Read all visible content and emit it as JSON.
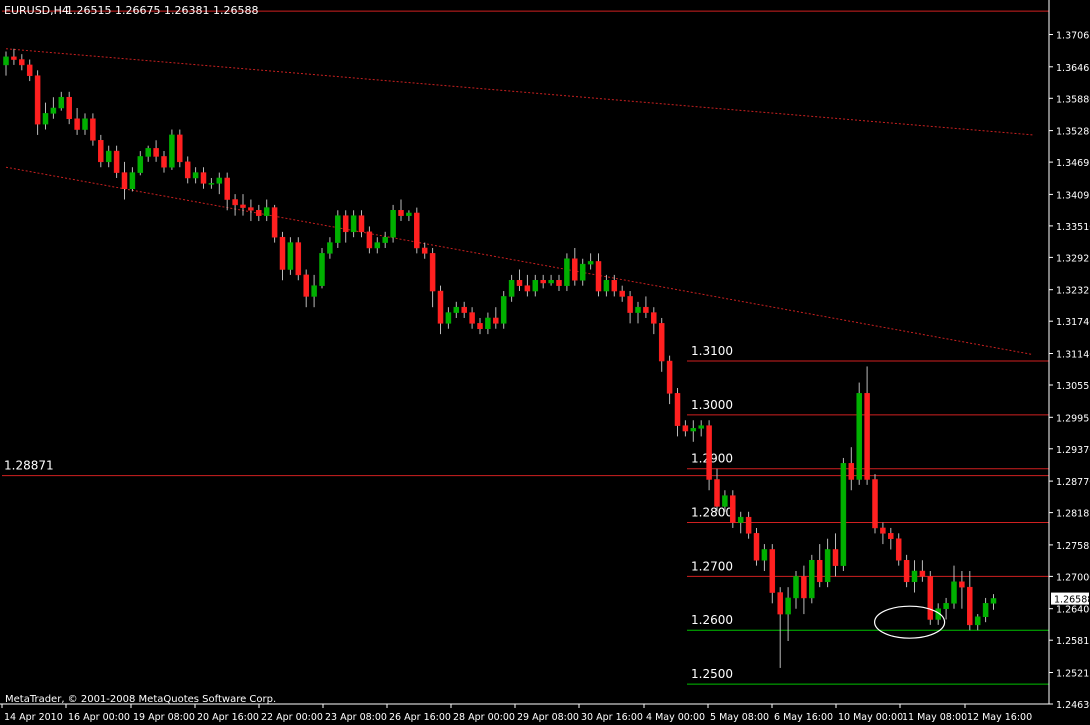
{
  "header": {
    "symbol": "EURUSD,H4",
    "ohlc": "1.26515 1.26675 1.26381 1.26588"
  },
  "footer": {
    "copyright": "MetaTrader, © 2001-2008 MetaQuotes Software Corp."
  },
  "colors": {
    "background": "#000000",
    "bull": "#00b000",
    "bear": "#ff2020",
    "level_line": "#d02020",
    "support_line": "#00c000",
    "trend_line": "#c82020",
    "axis": "#ffffff"
  },
  "chart_data": {
    "type": "candlestick",
    "timeframe": "H4",
    "ylim": [
      1.2463,
      1.3765
    ],
    "y_ticks": [
      "1.37065",
      "1.36465",
      "1.35880",
      "1.35280",
      "1.34695",
      "1.34095",
      "1.33510",
      "1.32925",
      "1.32325",
      "1.31740",
      "1.31140",
      "1.30555",
      "1.29955",
      "1.29370",
      "1.28770",
      "1.28185",
      "1.27585",
      "1.27000",
      "1.26400",
      "1.25815",
      "1.25215",
      "1.24630"
    ],
    "x_ticks": [
      "14 Apr 2010",
      "16 Apr 00:00",
      "19 Apr 08:00",
      "20 Apr 16:00",
      "22 Apr 00:00",
      "23 Apr 08:00",
      "26 Apr 16:00",
      "28 Apr 00:00",
      "29 Apr 08:00",
      "30 Apr 16:00",
      "4 May 00:00",
      "5 May 08:00",
      "6 May 16:00",
      "10 May 00:00",
      "11 May 08:00",
      "12 May 16:00"
    ],
    "current_price": "1.26588",
    "horizontal_levels": [
      {
        "label": "1.3100",
        "value": 1.31,
        "color": "red"
      },
      {
        "label": "1.3000",
        "value": 1.3,
        "color": "red"
      },
      {
        "label": "1.2900",
        "value": 1.29,
        "color": "red"
      },
      {
        "label": "1.2800",
        "value": 1.28,
        "color": "red"
      },
      {
        "label": "1.2700",
        "value": 1.27,
        "color": "red"
      },
      {
        "label": "1.2600",
        "value": 1.26,
        "color": "green"
      },
      {
        "label": "1.2500",
        "value": 1.25,
        "color": "green"
      }
    ],
    "extra_levels": [
      {
        "label": "1.28871",
        "value": 1.28871
      },
      {
        "label": "",
        "value": 1.375
      }
    ],
    "trend_lines": [
      {
        "from": {
          "bar": 0,
          "price": 1.368
        },
        "to": {
          "bar": 130,
          "price": 1.352
        }
      },
      {
        "from": {
          "bar": 0,
          "price": 1.346
        },
        "to": {
          "bar": 130,
          "price": 1.3112
        }
      }
    ],
    "annotation": {
      "type": "ellipse",
      "bar": 114,
      "price": 1.2615
    },
    "candles": [
      [
        1.365,
        1.3675,
        1.363,
        1.3665
      ],
      [
        1.3665,
        1.368,
        1.365,
        1.366
      ],
      [
        1.366,
        1.367,
        1.364,
        1.365
      ],
      [
        1.365,
        1.366,
        1.362,
        1.363
      ],
      [
        1.363,
        1.364,
        1.352,
        1.354
      ],
      [
        1.354,
        1.358,
        1.353,
        1.356
      ],
      [
        1.356,
        1.359,
        1.355,
        1.357
      ],
      [
        1.357,
        1.36,
        1.3565,
        1.359
      ],
      [
        1.359,
        1.36,
        1.354,
        1.355
      ],
      [
        1.355,
        1.357,
        1.352,
        1.353
      ],
      [
        1.353,
        1.356,
        1.352,
        1.355
      ],
      [
        1.355,
        1.356,
        1.35,
        1.351
      ],
      [
        1.351,
        1.352,
        1.346,
        1.347
      ],
      [
        1.347,
        1.35,
        1.346,
        1.349
      ],
      [
        1.349,
        1.35,
        1.344,
        1.345
      ],
      [
        1.345,
        1.347,
        1.34,
        1.342
      ],
      [
        1.342,
        1.346,
        1.3415,
        1.345
      ],
      [
        1.345,
        1.349,
        1.3445,
        1.348
      ],
      [
        1.348,
        1.35,
        1.347,
        1.3495
      ],
      [
        1.3495,
        1.351,
        1.347,
        1.348
      ],
      [
        1.348,
        1.349,
        1.345,
        1.346
      ],
      [
        1.346,
        1.353,
        1.3455,
        1.352
      ],
      [
        1.352,
        1.353,
        1.346,
        1.347
      ],
      [
        1.347,
        1.348,
        1.343,
        1.344
      ],
      [
        1.344,
        1.346,
        1.343,
        1.345
      ],
      [
        1.345,
        1.346,
        1.342,
        1.343
      ],
      [
        1.343,
        1.344,
        1.342,
        1.343
      ],
      [
        1.343,
        1.345,
        1.341,
        1.344
      ],
      [
        1.344,
        1.345,
        1.338,
        1.34
      ],
      [
        1.34,
        1.341,
        1.337,
        1.339
      ],
      [
        1.339,
        1.341,
        1.337,
        1.3385
      ],
      [
        1.3385,
        1.34,
        1.336,
        1.338
      ],
      [
        1.338,
        1.339,
        1.336,
        1.337
      ],
      [
        1.337,
        1.34,
        1.336,
        1.3385
      ],
      [
        1.3385,
        1.339,
        1.332,
        1.333
      ],
      [
        1.333,
        1.334,
        1.325,
        1.327
      ],
      [
        1.327,
        1.333,
        1.326,
        1.332
      ],
      [
        1.332,
        1.333,
        1.325,
        1.326
      ],
      [
        1.326,
        1.327,
        1.32,
        1.322
      ],
      [
        1.322,
        1.326,
        1.32,
        1.324
      ],
      [
        1.324,
        1.331,
        1.3235,
        1.33
      ],
      [
        1.33,
        1.333,
        1.329,
        1.332
      ],
      [
        1.332,
        1.338,
        1.331,
        1.337
      ],
      [
        1.337,
        1.338,
        1.332,
        1.334
      ],
      [
        1.334,
        1.338,
        1.333,
        1.337
      ],
      [
        1.337,
        1.338,
        1.333,
        1.334
      ],
      [
        1.334,
        1.335,
        1.33,
        1.331
      ],
      [
        1.331,
        1.333,
        1.33,
        1.332
      ],
      [
        1.332,
        1.334,
        1.331,
        1.333
      ],
      [
        1.333,
        1.339,
        1.332,
        1.338
      ],
      [
        1.338,
        1.34,
        1.336,
        1.337
      ],
      [
        1.337,
        1.338,
        1.336,
        1.3375
      ],
      [
        1.3375,
        1.3385,
        1.33,
        1.331
      ],
      [
        1.331,
        1.332,
        1.329,
        1.33
      ],
      [
        1.33,
        1.331,
        1.32,
        1.323
      ],
      [
        1.323,
        1.324,
        1.315,
        1.317
      ],
      [
        1.317,
        1.32,
        1.316,
        1.319
      ],
      [
        1.319,
        1.321,
        1.318,
        1.32
      ],
      [
        1.32,
        1.321,
        1.318,
        1.319
      ],
      [
        1.319,
        1.32,
        1.316,
        1.317
      ],
      [
        1.317,
        1.318,
        1.315,
        1.316
      ],
      [
        1.316,
        1.319,
        1.315,
        1.318
      ],
      [
        1.318,
        1.32,
        1.316,
        1.317
      ],
      [
        1.317,
        1.323,
        1.316,
        1.322
      ],
      [
        1.322,
        1.326,
        1.321,
        1.325
      ],
      [
        1.325,
        1.327,
        1.323,
        1.324
      ],
      [
        1.324,
        1.326,
        1.322,
        1.323
      ],
      [
        1.323,
        1.326,
        1.322,
        1.325
      ],
      [
        1.325,
        1.326,
        1.3235,
        1.3245
      ],
      [
        1.3245,
        1.326,
        1.324,
        1.325
      ],
      [
        1.325,
        1.326,
        1.323,
        1.324
      ],
      [
        1.324,
        1.33,
        1.323,
        1.329
      ],
      [
        1.329,
        1.331,
        1.324,
        1.325
      ],
      [
        1.325,
        1.329,
        1.324,
        1.328
      ],
      [
        1.328,
        1.33,
        1.327,
        1.3285
      ],
      [
        1.3285,
        1.33,
        1.322,
        1.323
      ],
      [
        1.323,
        1.326,
        1.322,
        1.325
      ],
      [
        1.325,
        1.326,
        1.322,
        1.323
      ],
      [
        1.323,
        1.324,
        1.321,
        1.322
      ],
      [
        1.322,
        1.323,
        1.317,
        1.319
      ],
      [
        1.319,
        1.321,
        1.317,
        1.32
      ],
      [
        1.32,
        1.322,
        1.318,
        1.319
      ],
      [
        1.319,
        1.32,
        1.315,
        1.317
      ],
      [
        1.317,
        1.318,
        1.308,
        1.31
      ],
      [
        1.31,
        1.311,
        1.302,
        1.304
      ],
      [
        1.304,
        1.305,
        1.296,
        1.298
      ],
      [
        1.298,
        1.299,
        1.296,
        1.297
      ],
      [
        1.297,
        1.299,
        1.295,
        1.2975
      ],
      [
        1.2975,
        1.299,
        1.296,
        1.298
      ],
      [
        1.298,
        1.299,
        1.286,
        1.288
      ],
      [
        1.288,
        1.29,
        1.282,
        1.283
      ],
      [
        1.283,
        1.286,
        1.282,
        1.285
      ],
      [
        1.285,
        1.286,
        1.279,
        1.28
      ],
      [
        1.28,
        1.282,
        1.278,
        1.281
      ],
      [
        1.281,
        1.282,
        1.277,
        1.278
      ],
      [
        1.278,
        1.279,
        1.272,
        1.273
      ],
      [
        1.273,
        1.276,
        1.271,
        1.275
      ],
      [
        1.275,
        1.276,
        1.265,
        1.267
      ],
      [
        1.267,
        1.268,
        1.253,
        1.263
      ],
      [
        1.263,
        1.268,
        1.258,
        1.266
      ],
      [
        1.266,
        1.271,
        1.264,
        1.27
      ],
      [
        1.27,
        1.272,
        1.263,
        1.266
      ],
      [
        1.266,
        1.274,
        1.265,
        1.273
      ],
      [
        1.273,
        1.276,
        1.268,
        1.269
      ],
      [
        1.269,
        1.277,
        1.268,
        1.275
      ],
      [
        1.275,
        1.278,
        1.27,
        1.272
      ],
      [
        1.272,
        1.292,
        1.271,
        1.291
      ],
      [
        1.291,
        1.294,
        1.286,
        1.288
      ],
      [
        1.288,
        1.306,
        1.287,
        1.304
      ],
      [
        1.304,
        1.309,
        1.287,
        1.288
      ],
      [
        1.288,
        1.289,
        1.278,
        1.279
      ],
      [
        1.279,
        1.28,
        1.276,
        1.278
      ],
      [
        1.278,
        1.279,
        1.275,
        1.277
      ],
      [
        1.277,
        1.278,
        1.272,
        1.273
      ],
      [
        1.273,
        1.274,
        1.268,
        1.269
      ],
      [
        1.269,
        1.273,
        1.267,
        1.271
      ],
      [
        1.271,
        1.273,
        1.269,
        1.27
      ],
      [
        1.27,
        1.271,
        1.261,
        1.262
      ],
      [
        1.262,
        1.265,
        1.261,
        1.264
      ],
      [
        1.264,
        1.266,
        1.262,
        1.265
      ],
      [
        1.265,
        1.272,
        1.264,
        1.269
      ],
      [
        1.269,
        1.271,
        1.264,
        1.268
      ],
      [
        1.268,
        1.271,
        1.26,
        1.261
      ],
      [
        1.261,
        1.263,
        1.26,
        1.2625
      ],
      [
        1.2625,
        1.266,
        1.2615,
        1.265
      ],
      [
        1.265,
        1.2667,
        1.2638,
        1.2659
      ]
    ]
  }
}
